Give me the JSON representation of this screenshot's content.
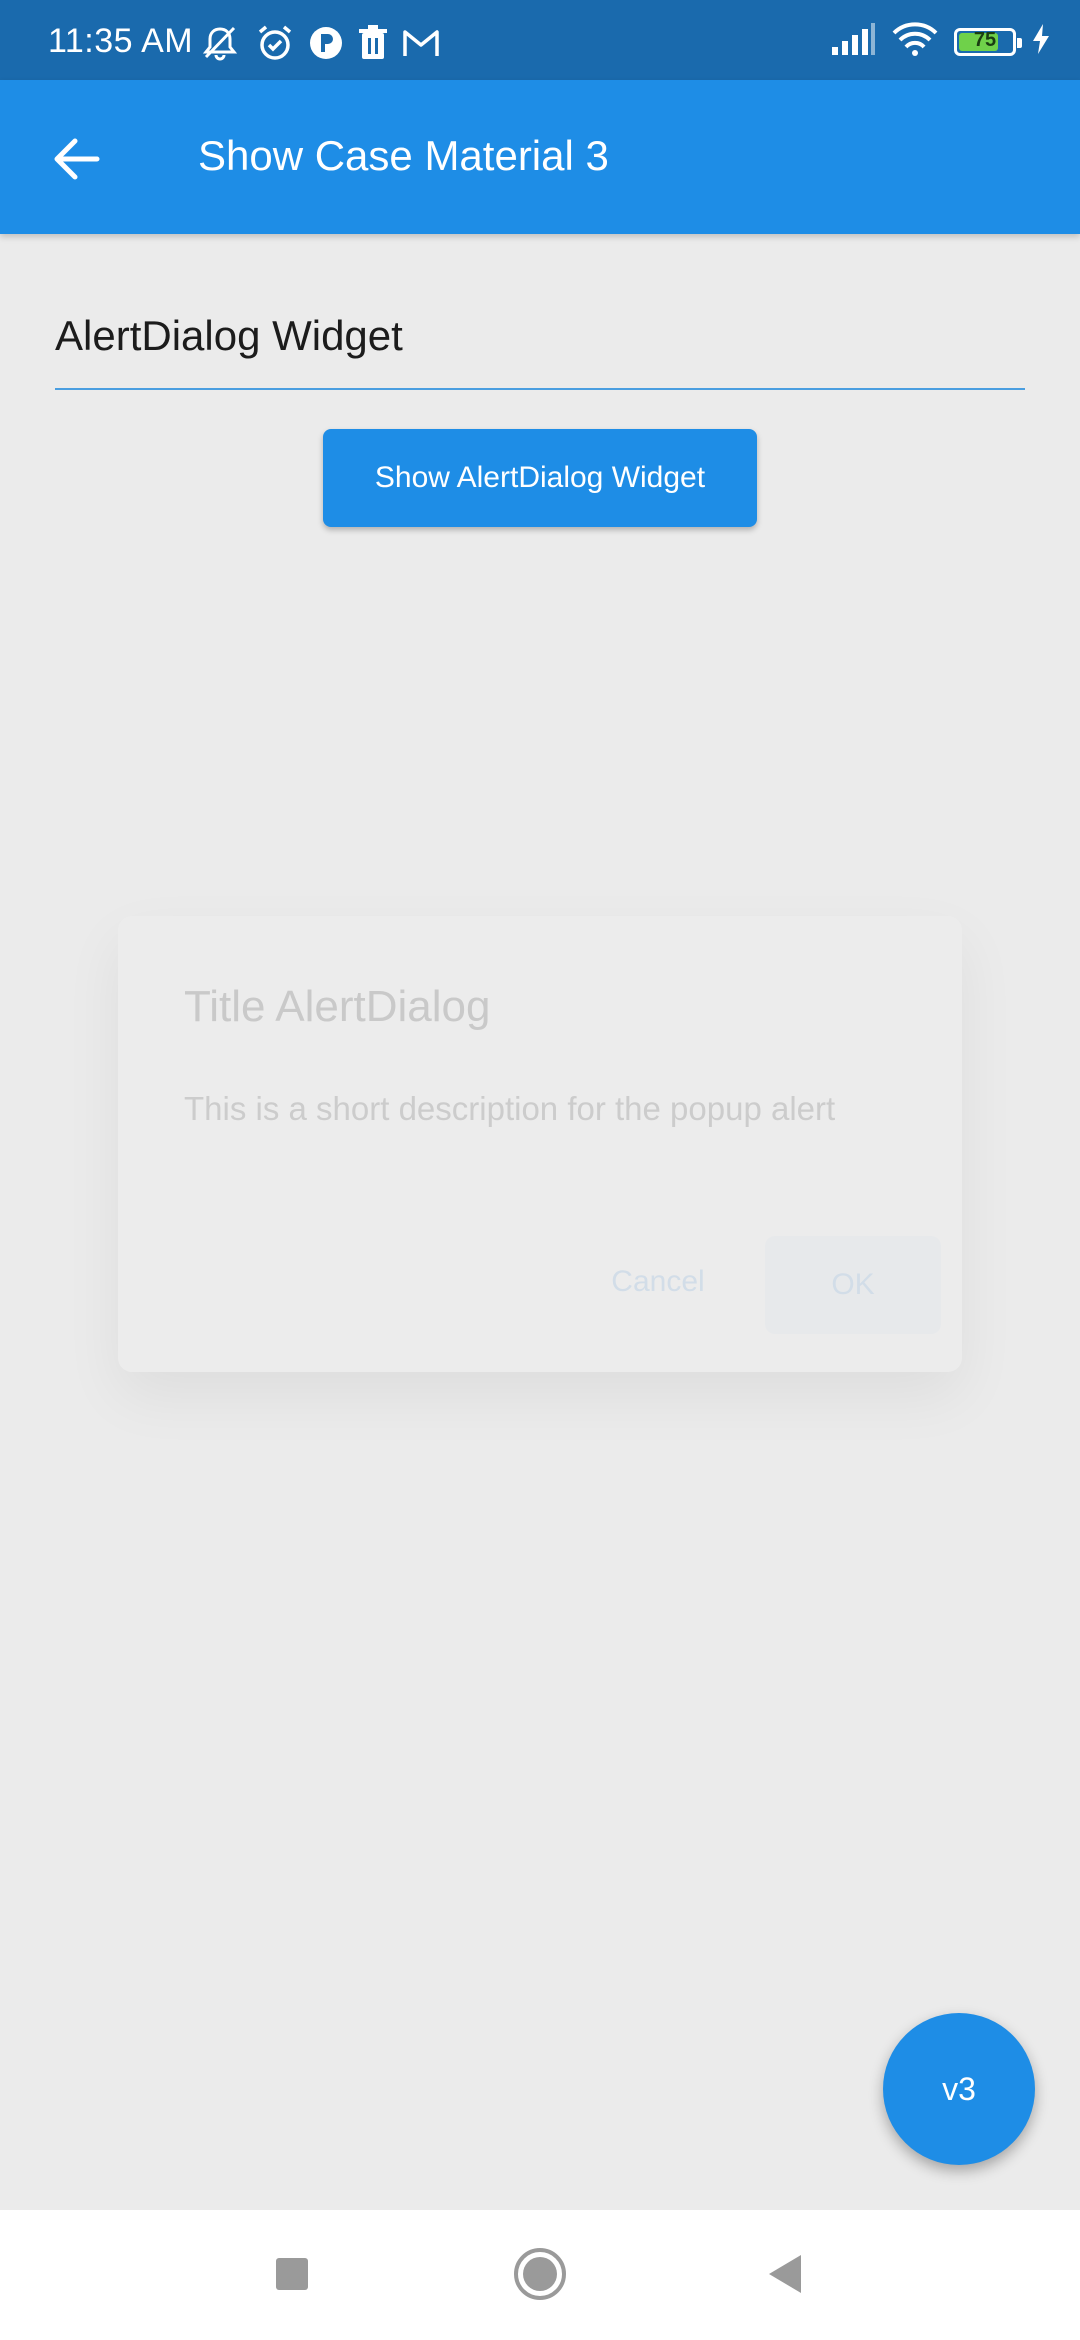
{
  "status_bar": {
    "time": "11:35 AM",
    "battery_level": "75",
    "battery_fraction": 0.75,
    "icons_left": [
      "mute-bell-icon",
      "alarm-icon",
      "app-p-icon",
      "trash-icon",
      "gmail-icon"
    ],
    "icons_right": [
      "signal-icon",
      "wifi-icon",
      "battery-icon",
      "charging-icon"
    ]
  },
  "app_bar": {
    "title": "Show Case Material 3",
    "back_icon": "arrow-back-icon"
  },
  "content": {
    "section_title": "AlertDialog Widget",
    "button_label": "Show AlertDialog Widget"
  },
  "dialog": {
    "title": "Title AlertDialog",
    "body": "This is a short description for the popup alert",
    "cancel_label": "Cancel",
    "ok_label": "OK"
  },
  "fab": {
    "label": "v3"
  },
  "nav_bar": {
    "items": [
      "recents-square-icon",
      "home-circle-icon",
      "back-triangle-icon"
    ]
  },
  "colors": {
    "status_bar": "#1a6aad",
    "app_bar": "#1e8de6",
    "background": "#ebebeb",
    "accent": "#1e8de6"
  }
}
